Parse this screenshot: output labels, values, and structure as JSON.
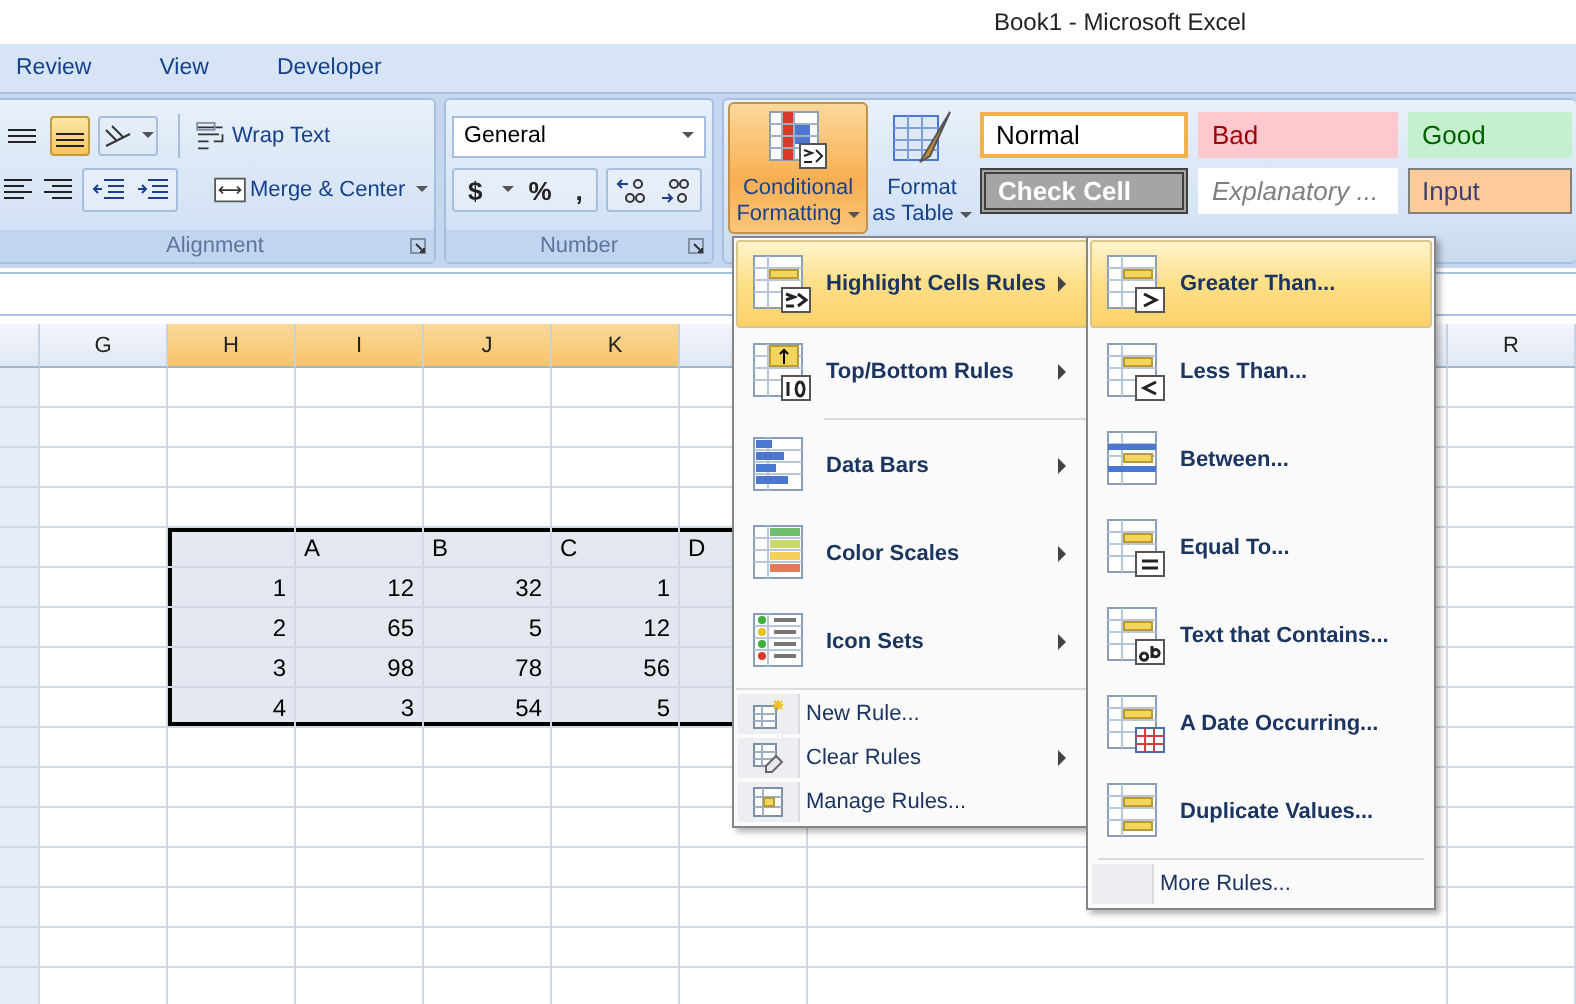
{
  "window": {
    "title": "Book1 - Microsoft Excel"
  },
  "ribbon_tabs": [
    {
      "label": "Review",
      "selected": false
    },
    {
      "label": "View",
      "selected": false
    },
    {
      "label": "Developer",
      "selected": false
    }
  ],
  "alignment_group": {
    "label": "Alignment",
    "vertical_align": [
      {
        "selected": false
      },
      {
        "selected": true
      }
    ],
    "wrap_text": "Wrap Text",
    "merge_center": "Merge & Center"
  },
  "number_group": {
    "label": "Number",
    "format": "General",
    "currency": "$",
    "percent": "%",
    "comma": ","
  },
  "styles_group": {
    "conditional_formatting": {
      "lines": [
        "Conditional",
        "Formatting"
      ],
      "expanded": true
    },
    "format_as_table": {
      "lines": [
        "Format",
        "as Table"
      ]
    },
    "cell_styles": [
      {
        "label": "Normal",
        "kind": "normal",
        "selected": true
      },
      {
        "label": "Bad",
        "kind": "bad",
        "selected": false
      },
      {
        "label": "Good",
        "kind": "good",
        "selected": false
      },
      {
        "label": "Check Cell",
        "kind": "check",
        "selected": false
      },
      {
        "label": "Explanatory ...",
        "kind": "explanatory",
        "selected": false
      },
      {
        "label": "Input",
        "kind": "input",
        "selected": false
      }
    ]
  },
  "sheet": {
    "columns": [
      {
        "label": "G",
        "selected": false
      },
      {
        "label": "H",
        "selected": true
      },
      {
        "label": "I",
        "selected": true
      },
      {
        "label": "J",
        "selected": true
      },
      {
        "label": "K",
        "selected": true
      },
      {
        "label": "R",
        "selected": false
      }
    ],
    "range": {
      "header": [
        "A",
        "B",
        "C",
        "D"
      ],
      "rows": [
        [
          "1",
          "12",
          "32",
          "1"
        ],
        [
          "2",
          "65",
          "5",
          "12"
        ],
        [
          "3",
          "98",
          "78",
          "56"
        ],
        [
          "4",
          "3",
          "54",
          "5"
        ]
      ]
    }
  },
  "conditional_menu": {
    "items": [
      {
        "label": "Highlight Cells Rules",
        "kind": "large",
        "selected": true,
        "submenu": true,
        "separator": false
      },
      {
        "label": "Top/Bottom Rules",
        "kind": "large",
        "selected": false,
        "submenu": true,
        "separator": false
      },
      {
        "label": "Data Bars",
        "kind": "large",
        "selected": false,
        "submenu": true,
        "separator": true
      },
      {
        "label": "Color Scales",
        "kind": "large",
        "selected": false,
        "submenu": true,
        "separator": false
      },
      {
        "label": "Icon Sets",
        "kind": "large",
        "selected": false,
        "submenu": true,
        "separator": false
      },
      {
        "label": "New Rule...",
        "kind": "small",
        "selected": false,
        "submenu": false,
        "separator": true
      },
      {
        "label": "Clear Rules",
        "kind": "small",
        "selected": false,
        "submenu": true,
        "separator": false
      },
      {
        "label": "Manage Rules...",
        "kind": "small",
        "selected": false,
        "submenu": false,
        "separator": false
      }
    ]
  },
  "highlight_submenu": {
    "items": [
      {
        "label": "Greater Than...",
        "kind": "large",
        "selected": true,
        "separator": false
      },
      {
        "label": "Less Than...",
        "kind": "large",
        "selected": false,
        "separator": false
      },
      {
        "label": "Between...",
        "kind": "large",
        "selected": false,
        "separator": false
      },
      {
        "label": "Equal To...",
        "kind": "large",
        "selected": false,
        "separator": false
      },
      {
        "label": "Text that Contains...",
        "kind": "large",
        "selected": false,
        "separator": false
      },
      {
        "label": "A Date Occurring...",
        "kind": "large",
        "selected": false,
        "separator": false
      },
      {
        "label": "Duplicate Values...",
        "kind": "large",
        "selected": false,
        "separator": false
      },
      {
        "label": "More Rules...",
        "kind": "small",
        "selected": false,
        "separator": true
      }
    ]
  }
}
